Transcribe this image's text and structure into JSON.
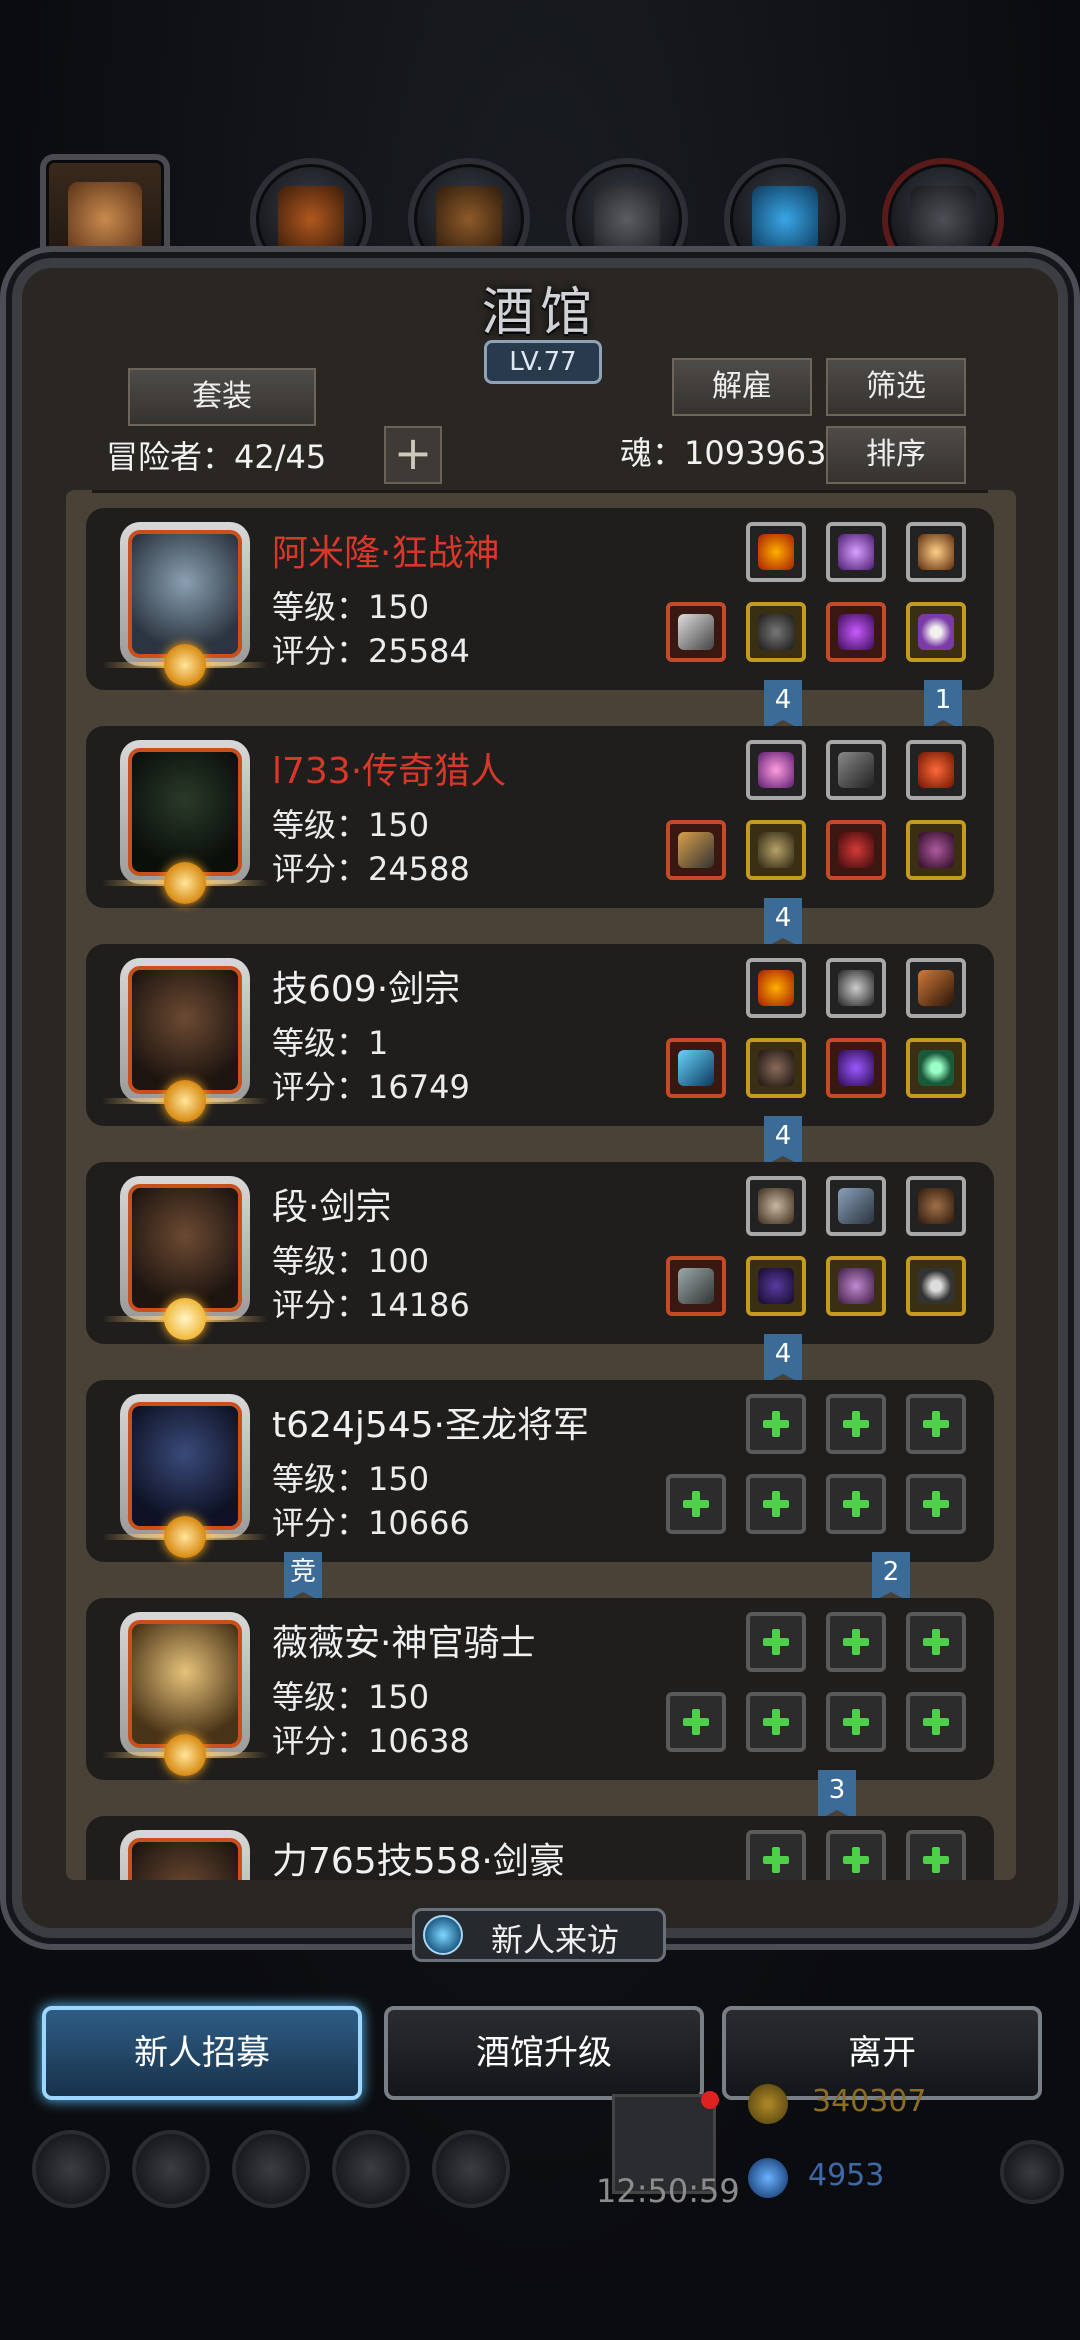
{
  "header": {
    "title": "酒馆",
    "level": "LV.77"
  },
  "toolbar": {
    "suit_label": "套装",
    "dismiss_label": "解雇",
    "filter_label": "筛选",
    "sort_label": "排序",
    "adventurers_label": "冒险者：42/45",
    "add_label": "+",
    "soul_label": "魂：1093963"
  },
  "heroes": [
    {
      "name": "阿米隆·狂战神",
      "level": "等级：150",
      "score": "评分：25584",
      "name_color": "red",
      "tags": [
        "4",
        "1"
      ]
    },
    {
      "name": "l733·传奇猎人",
      "level": "等级：150",
      "score": "评分：24588",
      "name_color": "red",
      "tags": [
        "4"
      ]
    },
    {
      "name": "技609·剑宗",
      "level": "等级：1",
      "score": "评分：16749",
      "name_color": "white",
      "tags": [
        "4"
      ]
    },
    {
      "name": "段·剑宗",
      "level": "等级：100",
      "score": "评分：14186",
      "name_color": "white",
      "tags": [
        "4"
      ]
    },
    {
      "name": "t624j545·圣龙将军",
      "level": "等级：150",
      "score": "评分：10666",
      "name_color": "white",
      "tags": [
        "竞",
        "2"
      ]
    },
    {
      "name": "薇薇安·神官骑士",
      "level": "等级：150",
      "score": "评分：10638",
      "name_color": "white",
      "tags": [
        "3"
      ]
    },
    {
      "name": "力765技558·剑豪",
      "level": "",
      "score": "",
      "name_color": "white",
      "tags": []
    }
  ],
  "banner": {
    "label": "新人来访"
  },
  "actions": {
    "recruit": "新人招募",
    "upgrade": "酒馆升级",
    "leave": "离开"
  },
  "hud": {
    "time": "12:50:59",
    "gold": "340307",
    "gems": "4953"
  },
  "colors": {
    "accent": "#5cc3ff",
    "name_red": "#d8382a",
    "plus_green": "#4ed04a"
  }
}
